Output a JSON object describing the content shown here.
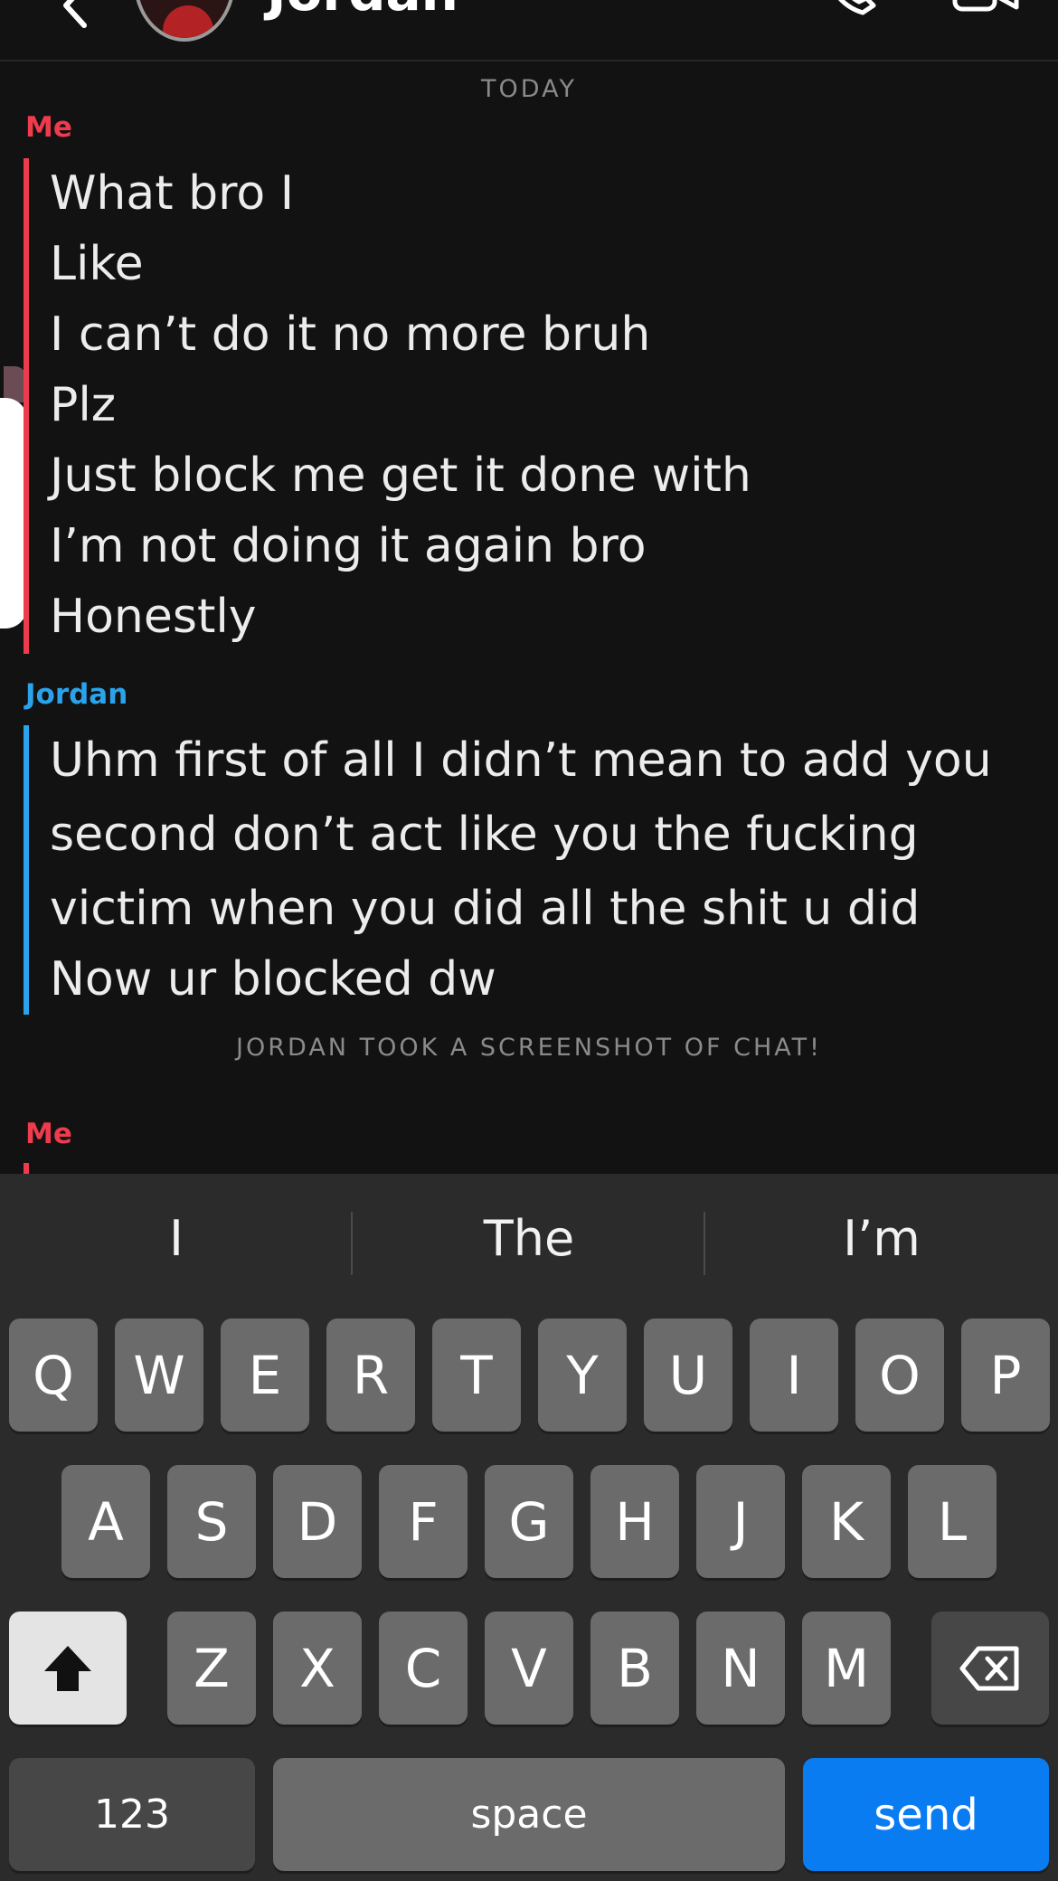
{
  "header": {
    "title": "Jordan"
  },
  "chat": {
    "day_divider": "TODAY",
    "groups": [
      {
        "sender": "Me",
        "messages": [
          "What bro I",
          "Like",
          "I can’t do it no more bruh",
          "Plz",
          "Just block me get it done with",
          "I’m not doing it again bro",
          "Honestly"
        ]
      },
      {
        "sender": "Jordan",
        "messages": [
          "Uhm first of all I didn’t mean to add you",
          "second don’t act like you the fucking",
          "victim when you did all the shit u did",
          "Now ur blocked dw"
        ]
      },
      {
        "sender": "Me",
        "messages": []
      }
    ],
    "system_note": "JORDAN TOOK A SCREENSHOT OF CHAT!"
  },
  "keyboard": {
    "suggestions": [
      "I",
      "The",
      "I’m"
    ],
    "row1": [
      "Q",
      "W",
      "E",
      "R",
      "T",
      "Y",
      "U",
      "I",
      "O",
      "P"
    ],
    "row2": [
      "A",
      "S",
      "D",
      "F",
      "G",
      "H",
      "J",
      "K",
      "L"
    ],
    "row3": [
      "Z",
      "X",
      "C",
      "V",
      "B",
      "N",
      "M"
    ],
    "numbers_label": "123",
    "space_label": "space",
    "send_label": "send",
    "shift_icon": "shift-icon",
    "delete_icon": "backspace-icon"
  },
  "colors": {
    "me": "#ee3b4e",
    "friend": "#2aa3ea",
    "send_button": "#0a7cf2"
  }
}
